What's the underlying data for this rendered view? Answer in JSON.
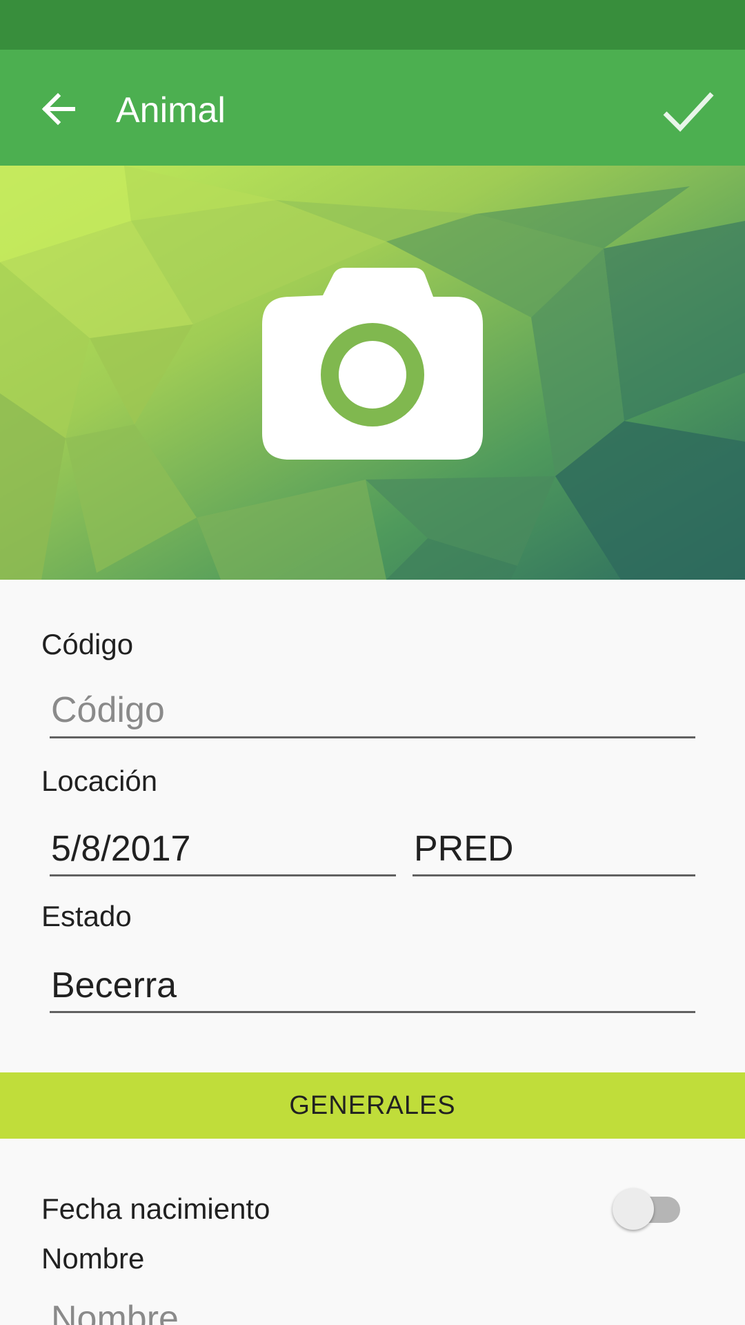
{
  "app_bar": {
    "title": "Animal",
    "back_icon": "arrow-back-icon",
    "confirm_icon": "check-icon"
  },
  "header": {
    "camera_icon": "camera-icon"
  },
  "form": {
    "codigo": {
      "label": "Código",
      "placeholder": "Código",
      "value": ""
    },
    "locacion": {
      "label": "Locación",
      "date_value": "5/8/2017",
      "location_value": "PRED"
    },
    "estado": {
      "label": "Estado",
      "value": "Becerra"
    }
  },
  "section_generales": {
    "label": "GENERALES"
  },
  "generales": {
    "fecha_nacimiento": {
      "label": "Fecha nacimiento",
      "toggle_on": false
    },
    "nombre": {
      "label": "Nombre",
      "placeholder": "Nombre"
    }
  },
  "colors": {
    "status_bar": "#388e3c",
    "app_bar": "#4caf50",
    "section_bar": "#c0dd3a",
    "background": "#f9f9f9"
  }
}
